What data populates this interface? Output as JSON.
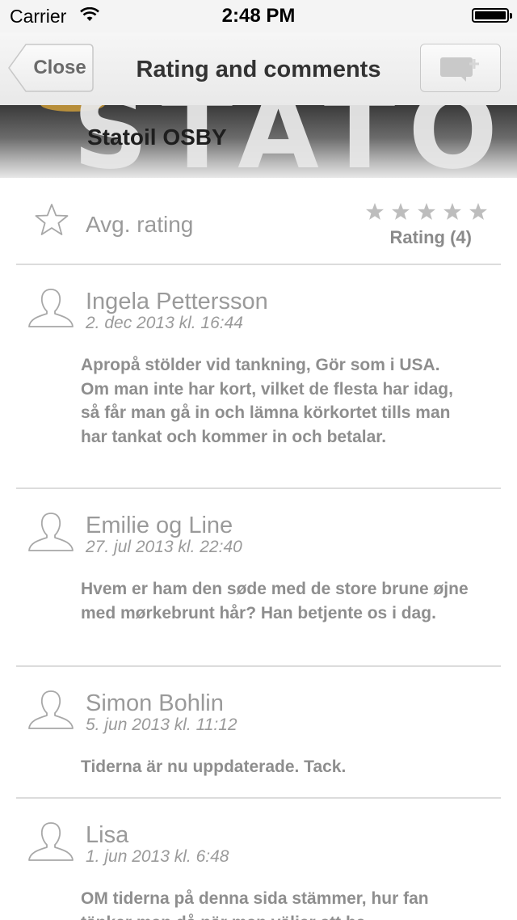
{
  "status_bar": {
    "carrier": "Carrier",
    "time": "2:48 PM"
  },
  "nav": {
    "close_label": "Close",
    "title": "Rating and comments"
  },
  "hero": {
    "sign_text": "STATOIL",
    "station_name": "Statoil OSBY"
  },
  "rating": {
    "label": "Avg. rating",
    "count_label": "Rating (4)",
    "stars_filled": 0,
    "stars_total": 5
  },
  "comments": [
    {
      "author": "Ingela Pettersson",
      "date": "2. dec 2013 kl. 16:44",
      "text": "Apropå stölder vid tankning, Gör som i USA. Om man inte har kort, vilket de flesta har idag, så får man gå in och lämna körkortet tills man har tankat och kommer in och betalar."
    },
    {
      "author": "Emilie og Line",
      "date": "27. jul 2013 kl. 22:40",
      "text": "Hvem er ham den søde med de store brune øjne med mørkebrunt hår? Han betjente os i dag."
    },
    {
      "author": "Simon Bohlin",
      "date": "5. jun 2013 kl. 11:12",
      "text": "Tiderna är nu uppdaterade. Tack."
    },
    {
      "author": "Lisa",
      "date": "1. jun 2013 kl. 6:48",
      "text": "OM tiderna på denna sida stämmer, hur fan tänker man då när man väljer att ha"
    }
  ],
  "colors": {
    "text_grey": "#8e8e8e",
    "divider": "#dcdcdc",
    "star_grey": "#bdbdbd"
  }
}
